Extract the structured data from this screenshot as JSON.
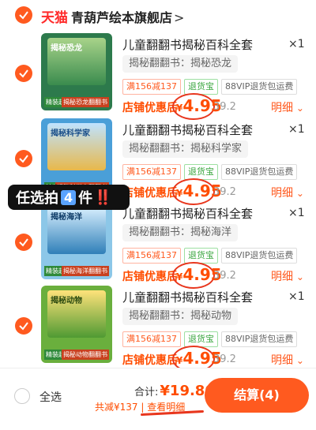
{
  "header": {
    "brand": "天猫",
    "shop_name": "青葫芦绘本旗舰店",
    "arrow": ">"
  },
  "items": [
    {
      "title": "儿童翻翻书揭秘百科全套",
      "quantity": "×1",
      "spec": "揭秘翻翻书：揭秘恐龙",
      "tags": [
        "满156减137",
        "退货宝",
        "88VIP退货包运费"
      ],
      "discount_label": "店铺优惠后",
      "price_yen": "¥",
      "price": "4.95",
      "original": "39.2",
      "detail": "明细",
      "thumb_title": "揭秘恐龙",
      "thumb_badge1": "精装超板书",
      "thumb_badge2": "揭秘恐龙翻翻书"
    },
    {
      "title": "儿童翻翻书揭秘百科全套",
      "quantity": "×1",
      "spec": "揭秘翻翻书：揭秘科学家",
      "tags": [
        "满156减137",
        "退货宝",
        "88VIP退货包运费"
      ],
      "discount_label": "店铺优惠后",
      "price_yen": "¥",
      "price": "4.95",
      "original": "39.2",
      "detail": "明细",
      "thumb_title": "揭秘科学家",
      "thumb_badge1": "精装超板书",
      "thumb_badge2": "揭秘科学家翻翻书"
    },
    {
      "title": "儿童翻翻书揭秘百科全套",
      "quantity": "×1",
      "spec": "揭秘翻翻书：揭秘海洋",
      "tags": [
        "满156减137",
        "退货宝",
        "88VIP退货包运费"
      ],
      "discount_label": "店铺优惠后",
      "price_yen": "¥",
      "price": "4.95",
      "original": "39.2",
      "detail": "明细",
      "thumb_title": "揭秘海洋",
      "thumb_badge1": "精装超板书",
      "thumb_badge2": "揭秘海洋翻翻书"
    },
    {
      "title": "儿童翻翻书揭秘百科全套",
      "quantity": "×1",
      "spec": "揭秘翻翻书：揭秘动物",
      "tags": [
        "满156减137",
        "退货宝",
        "88VIP退货包运费"
      ],
      "discount_label": "店铺优惠后",
      "price_yen": "¥",
      "price": "4.95",
      "original": "39.2",
      "detail": "明细",
      "thumb_title": "揭秘动物",
      "thumb_badge1": "精装超板书",
      "thumb_badge2": "揭秘动物翻翻书"
    }
  ],
  "overlay": {
    "text_before": "任选拍",
    "number": "4",
    "text_after": "件",
    "emphasis": "‼️"
  },
  "footer": {
    "select_all": "全选",
    "total_label": "合计:",
    "total_amount": "¥19.80",
    "savings": "共减¥137 | 查看明细",
    "checkout": "结算(4)"
  },
  "colors": {
    "accent": "#ff5a1f",
    "price": "#ff4d00",
    "brand_red": "#ff2a2a"
  }
}
